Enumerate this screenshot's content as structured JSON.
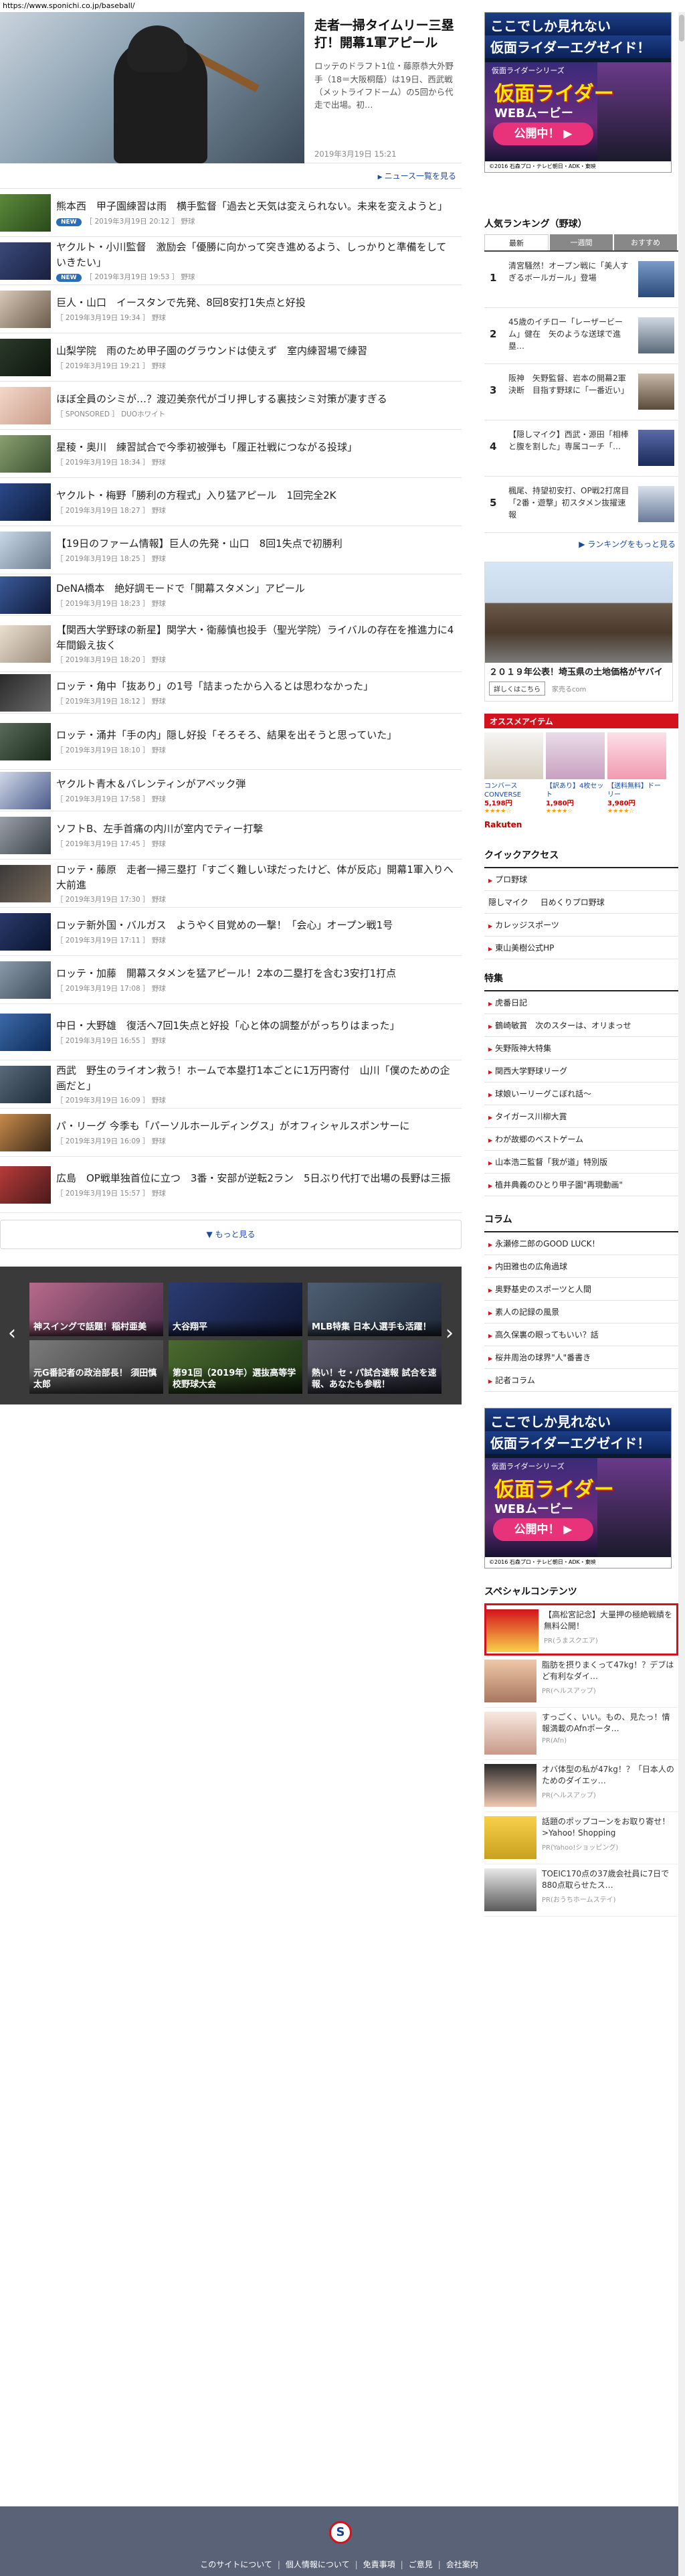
{
  "url": "https://www.sponichi.co.jp/baseball/",
  "hero": {
    "title": "走者一掃タイムリー三塁打！開幕1軍アピール",
    "lead": "ロッテのドラフト1位・藤原恭大外野手（18＝大阪桐蔭）は19日、西武戦（メットライフドーム）の5回から代走で出場。初…",
    "date": "2019年3月19日 15:21"
  },
  "news_more_label": "ニュース一覧を見る",
  "news": [
    {
      "title": "熊本西　甲子園練習は雨　横手監督「過去と天気は変えられない。未来を変えようと」",
      "meta": "［ 2019年3月19日 20:12 ］ 野球",
      "new": "NEW"
    },
    {
      "title": "ヤクルト・小川監督　激励会「優勝に向かって突き進めるよう、しっかりと準備をしていきたい」",
      "meta": "［ 2019年3月19日 19:53 ］ 野球",
      "new": "NEW"
    },
    {
      "title": "巨人・山口　イースタンで先発、8回8安打1失点と好投",
      "meta": "［ 2019年3月19日 19:34 ］ 野球",
      "new": ""
    },
    {
      "title": "山梨学院　雨のため甲子園のグラウンドは使えず　室内練習場で練習",
      "meta": "［ 2019年3月19日 19:21 ］ 野球",
      "new": ""
    },
    {
      "title": "ほぼ全員のシミが…？渡辺美奈代がゴリ押しする裏技シミ対策が凄すぎる",
      "meta": "［ SPONSORED ］ DUOホワイト",
      "new": ""
    },
    {
      "title": "星稜・奥川　練習試合で今季初被弾も「履正社戦につながる投球」",
      "meta": "［ 2019年3月19日 18:34 ］ 野球",
      "new": ""
    },
    {
      "title": "ヤクルト・梅野「勝利の方程式」入り猛アピール　1回完全2K",
      "meta": "［ 2019年3月19日 18:27 ］ 野球",
      "new": ""
    },
    {
      "title": "【19日のファーム情報】巨人の先発・山口　8回1失点で初勝利",
      "meta": "［ 2019年3月19日 18:25 ］ 野球",
      "new": ""
    },
    {
      "title": "DeNA橋本　絶好調モードで「開幕スタメン」アピール",
      "meta": "［ 2019年3月19日 18:23 ］ 野球",
      "new": ""
    },
    {
      "title": "【関西大学野球の新星】関学大・衛藤慎也投手（聖光学院）ライバルの存在を推進力に4年間鍛え抜く",
      "meta": "［ 2019年3月19日 18:20 ］ 野球",
      "new": ""
    },
    {
      "title": "ロッテ・角中「抜あり」の1号「詰まったから入るとは思わなかった」",
      "meta": "［ 2019年3月19日 18:12 ］ 野球",
      "new": ""
    },
    {
      "title": "ロッテ・涌井「手の内」隠し好投「そろそろ、結果を出そうと思っていた」",
      "meta": "［ 2019年3月19日 18:10 ］ 野球",
      "new": ""
    },
    {
      "title": "ヤクルト青木＆バレンティンがアベック弾",
      "meta": "［ 2019年3月19日 17:58 ］ 野球",
      "new": ""
    },
    {
      "title": "ソフトB、左手首痛の内川が室内でティー打撃",
      "meta": "［ 2019年3月19日 17:45 ］ 野球",
      "new": ""
    },
    {
      "title": "ロッテ・藤原　走者一掃三塁打「すごく難しい球だったけど、体が反応」開幕1軍入りへ大前進",
      "meta": "［ 2019年3月19日 17:30 ］ 野球",
      "new": ""
    },
    {
      "title": "ロッテ新外国・バルガス　ようやく目覚めの一撃！「会心」オープン戦1号",
      "meta": "［ 2019年3月19日 17:11 ］ 野球",
      "new": ""
    },
    {
      "title": "ロッテ・加藤　開幕スタメンを猛アピール！2本の二塁打を含む3安打1打点",
      "meta": "［ 2019年3月19日 17:08 ］ 野球",
      "new": ""
    },
    {
      "title": "中日・大野雄　復活へ7回1失点と好投「心と体の調整ががっちりはまった」",
      "meta": "［ 2019年3月19日 16:55 ］ 野球",
      "new": ""
    },
    {
      "title": "西武　野生のライオン救う！ホームで本塁打1本ごとに1万円寄付　山川「僕のための企画だと」",
      "meta": "［ 2019年3月19日 16:09 ］ 野球",
      "new": ""
    },
    {
      "title": "パ・リーグ 今季も「パーソルホールディングス」がオフィシャルスポンサーに",
      "meta": "［ 2019年3月19日 16:09 ］ 野球",
      "new": ""
    },
    {
      "title": "広島　OP戦単独首位に立つ　3番・安部が逆転2ラン　5日ぶり代打で出場の長野は三振",
      "meta": "［ 2019年3月19日 15:57 ］ 野球",
      "new": ""
    }
  ],
  "more_button": "もっと見る",
  "carousel": [
    {
      "caption": "神スイングで話題！稲村亜美"
    },
    {
      "caption": "大谷翔平"
    },
    {
      "caption": "MLB特集 日本人選手も活躍！"
    },
    {
      "caption": "元G番記者の政治部長！ 須田慎太郎"
    },
    {
      "caption": "第91回（2019年）選抜高等学校野球大会"
    },
    {
      "caption": "熱い！セ・パ試合速報 試合を速報、あなたも参戦！"
    }
  ],
  "ad": {
    "line1": "ここでしか見れない",
    "line2": "仮面ライダーエグゼイド！",
    "small": "仮面ライダーシリーズ",
    "logo": "仮面ライダー",
    "web": "WEBムービー",
    "button": "公開中！ ▶",
    "copyright": "©2016 石森プロ・テレビ朝日・ADK・東映"
  },
  "ranking": {
    "title": "人気ランキング（野球）",
    "tabs": [
      "最新",
      "一週間",
      "おすすめ"
    ],
    "items": [
      {
        "num": "1",
        "title": "清宮騒然！オープン戦に「美人すぎるボールガール」登場"
      },
      {
        "num": "2",
        "title": "45歳のイチロー「レーザービーム」健在　矢のような送球で進塁…"
      },
      {
        "num": "3",
        "title": "阪神　矢野監督、岩本の開幕2軍決断　目指す野球に「一番近い」"
      },
      {
        "num": "4",
        "title": "【隠しマイク】西武・源田「相棒と腹を割した」専属コーチ「…"
      },
      {
        "num": "5",
        "title": "楓尾、持望初安打、OP戦2打席目「2番・遊撃」初スタメン抜擢速報"
      }
    ],
    "more": "ランキングをもっと見る"
  },
  "house_ad": {
    "text": "２０１９年公表！埼玉県の土地価格がヤバイ",
    "button": "詳しくはこちら",
    "from": "家売るcom"
  },
  "osusume": {
    "bar": "オススメアイテム",
    "brand": "Rakuten",
    "items": [
      {
        "label": "コンバース CONVERSE",
        "price": "5,198円",
        "stars": "★★★★☆"
      },
      {
        "label": "【訳あり】4枚セット",
        "price": "1,980円",
        "stars": "★★★★☆"
      },
      {
        "label": "【送料無料】ドーリー",
        "price": "3,980円",
        "stars": "★★★★☆"
      }
    ]
  },
  "quick": {
    "title": "クイックアクセス",
    "links": [
      "プロ野球",
      "隠しマイク",
      "日めくりプロ野球",
      "カレッジスポーツ",
      "東山美樹公式HP"
    ]
  },
  "features": {
    "title": "特集",
    "links": [
      "虎番日記",
      "鶴崎敏賞　次のスターは、オリまっせ",
      "矢野阪神大特集",
      "関西大学野球リーグ",
      "球娘いーリーグこぼれ話～",
      "タイガース川柳大賞",
      "わが故郷のベストゲーム",
      "山本浩二監督「我が道」特別版",
      "植井典義のひとり甲子園\"再現動画\""
    ]
  },
  "columns": {
    "title": "コラム",
    "links": [
      "永瀬修二郎のGOOD LUCK！",
      "内田雅也の広角過球",
      "奥野基史のスポーツと人間",
      "素人の記録の風景",
      "高久保裏の眼ってもいい？話",
      "桜井周治の球界\"人\"番書き",
      "記者コラム"
    ]
  },
  "special": {
    "title": "スペシャルコンテンツ",
    "items": [
      {
        "title": "【高松宮記念】大量押の極絶戦績を無料公開！",
        "from": "PR(うまスクエア)"
      },
      {
        "title": "脂肪を摂りまくって47kg！？デブはど有利なダイ…",
        "from": "PR(ヘルスアップ)"
      },
      {
        "title": "すっごく、いい。もの、見たっ！情報満載のAfnポータ…",
        "from": "PR(Afn)"
      },
      {
        "title": "オバ体型の私が47kg！？「日本人のためのダイエッ…",
        "from": "PR(ヘルスアップ)"
      },
      {
        "title": "話題のポップコーンをお取り寄せ！>Yahoo! Shopping",
        "from": "PR(Yahoo!ショッピング)"
      },
      {
        "title": "TOEIC170点の37歳会社員に7日で880点取らせたス…",
        "from": "PR(おうちホームステイ)"
      }
    ]
  },
  "footer": {
    "logo": "S",
    "links": [
      "このサイトについて",
      "個人情報について",
      "免責事項",
      "ご意見",
      "会社案内"
    ]
  },
  "colors": {
    "accent": "#d3121c",
    "link": "#1b4ba0",
    "footer": "#5a6277"
  }
}
